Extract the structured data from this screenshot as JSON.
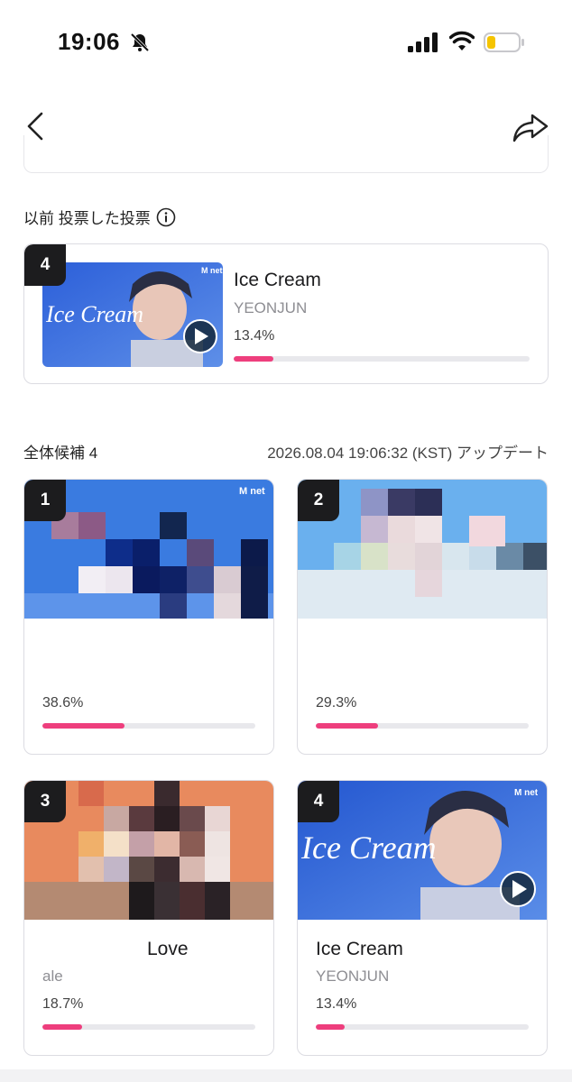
{
  "status": {
    "time": "19:06"
  },
  "previous_section": {
    "label": "以前 投票した投票"
  },
  "previous_vote": {
    "rank": "4",
    "title": "Ice Cream",
    "artist": "YEONJUN",
    "percent_label": "13.4%",
    "percent": 13.4,
    "thumb_text": "Ice Cream",
    "thumb_badge": "M net"
  },
  "candidates": {
    "count_label": "全体候補 4",
    "updated_label": "2026.08.04 19:06:32 (KST) アップデート",
    "items": [
      {
        "rank": "1",
        "title": "",
        "artist": "",
        "percent_label": "38.6%",
        "percent": 38.6,
        "thumb_badge": "M net"
      },
      {
        "rank": "2",
        "title": "",
        "artist": "",
        "percent_label": "29.3%",
        "percent": 29.3,
        "thumb_badge": ""
      },
      {
        "rank": "3",
        "title": "Love",
        "artist": "ale",
        "percent_label": "18.7%",
        "percent": 18.7,
        "thumb_badge": ""
      },
      {
        "rank": "4",
        "title": "Ice Cream",
        "artist": "YEONJUN",
        "percent_label": "13.4%",
        "percent": 13.4,
        "thumb_badge": "M net",
        "thumb_text": "Ice Cream"
      }
    ]
  },
  "colors": {
    "accent": "#ee3e7d",
    "badge": "#1c1c1e"
  },
  "icons": [
    "bell-slash-icon",
    "signal-icon",
    "wifi-icon",
    "battery-icon",
    "back-chevron-icon",
    "share-icon",
    "info-icon",
    "play-icon"
  ]
}
